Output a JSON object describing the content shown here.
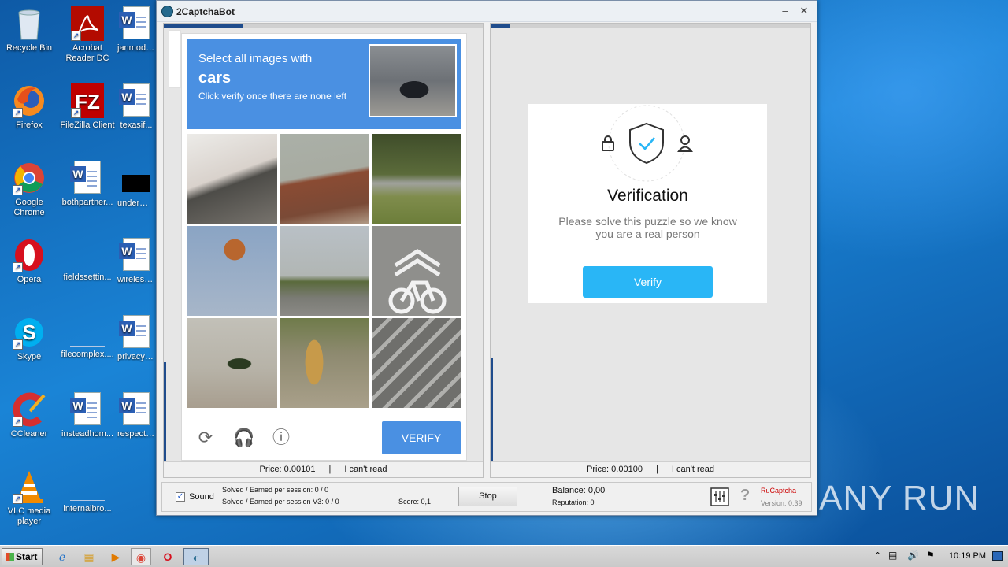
{
  "desktop": {
    "icons": [
      {
        "label": "Recycle Bin",
        "icon": "recycle-bin-icon"
      },
      {
        "label": "Acrobat Reader DC",
        "icon": "acrobat-icon"
      },
      {
        "label": "janmodul...",
        "icon": "word-doc-icon"
      },
      {
        "label": "Firefox",
        "icon": "firefox-icon"
      },
      {
        "label": "FileZilla Client",
        "icon": "filezilla-icon"
      },
      {
        "label": "texasif...",
        "icon": "word-doc-icon"
      },
      {
        "label": "Google Chrome",
        "icon": "chrome-icon"
      },
      {
        "label": "bothpartner...",
        "icon": "word-doc-icon"
      },
      {
        "label": "underman...",
        "icon": "black-file-icon"
      },
      {
        "label": "Opera",
        "icon": "opera-icon"
      },
      {
        "label": "fieldssettin...",
        "icon": "blank-file-icon"
      },
      {
        "label": "wirelessn...",
        "icon": "word-doc-icon"
      },
      {
        "label": "Skype",
        "icon": "skype-icon"
      },
      {
        "label": "filecomplex....",
        "icon": "blank-file-icon"
      },
      {
        "label": "privacym...",
        "icon": "word-doc-icon"
      },
      {
        "label": "CCleaner",
        "icon": "ccleaner-icon"
      },
      {
        "label": "insteadhom...",
        "icon": "word-doc-icon"
      },
      {
        "label": "respectiv...",
        "icon": "word-doc-icon"
      },
      {
        "label": "VLC media player",
        "icon": "vlc-icon"
      },
      {
        "label": "internalbro...",
        "icon": "blank-file-icon"
      }
    ]
  },
  "window": {
    "title": "2CaptchaBot",
    "minimize": "–",
    "close": "✕"
  },
  "left_pane": {
    "progress": 0.25,
    "captcha": {
      "line1": "Select all images with",
      "line2": "cars",
      "line3": "Click verify once there are none left",
      "verify_label": "VERIFY"
    },
    "status": {
      "price": "Price: 0.00101",
      "sep": "|",
      "cant_read": "I can't read"
    }
  },
  "right_pane": {
    "progress": 0.06,
    "verification": {
      "title": "Verification",
      "message": "Please solve this puzzle so we know you are a real person",
      "button": "Verify"
    },
    "status": {
      "price": "Price: 0.00100",
      "sep": "|",
      "cant_read": "I can't read"
    }
  },
  "bottom": {
    "sound_label": "Sound",
    "sound_checked": true,
    "solved1": "Solved / Earned per session: 0 / 0",
    "solved2": "Solved / Earned per session V3: 0 / 0",
    "score": "Score: 0,1",
    "stop": "Stop",
    "balance": "Balance:  0,00",
    "reputation": "Reputation: 0",
    "brand": "RuCaptcha",
    "version": "Version: 0.39"
  },
  "taskbar": {
    "start": "Start",
    "clock": "10:19 PM"
  },
  "watermark": "ANY RUN",
  "colors": {
    "captcha_blue": "#4a90e2",
    "verify_cyan": "#29b6f6",
    "brand_red": "#cc0000"
  }
}
